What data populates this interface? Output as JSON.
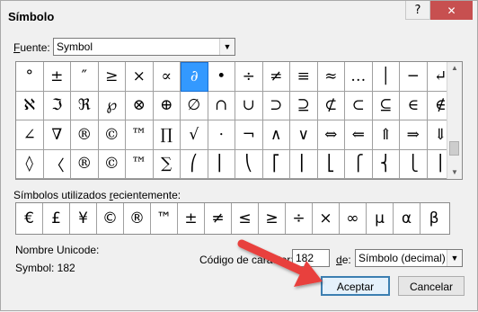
{
  "window": {
    "title": "Símbolo",
    "help_label": "?",
    "close_label": "✕"
  },
  "font": {
    "label_prefix": "",
    "label_accel": "F",
    "label_rest": "uente:",
    "value": "Symbol"
  },
  "symbols": [
    "°",
    "±",
    "″",
    "≥",
    "×",
    "∝",
    "∂",
    "•",
    "÷",
    "≠",
    "≡",
    "≈",
    "…",
    "│",
    "─",
    "↵",
    "ℵ",
    "ℑ",
    "ℜ",
    "℘",
    "⊗",
    "⊕",
    "∅",
    "∩",
    "∪",
    "⊃",
    "⊇",
    "⊄",
    "⊂",
    "⊆",
    "∈",
    "∉",
    "∠",
    "∇",
    "®",
    "©",
    "™",
    "∏",
    "√",
    "⋅",
    "¬",
    "∧",
    "∨",
    "⇔",
    "⇐",
    "⇑",
    "⇒",
    "⇓",
    "◊",
    "〈",
    "®",
    "©",
    "™",
    "∑",
    "⎛",
    "⎜",
    "⎝",
    "⎡",
    "⎢",
    "⎣",
    "⎧",
    "⎨",
    "⎩",
    "⎪"
  ],
  "selected_index": 6,
  "recent": {
    "label_prefix": "Símbolos utilizados ",
    "label_accel": "r",
    "label_rest": "ecientemente:",
    "symbols": [
      "€",
      "£",
      "¥",
      "©",
      "®",
      "™",
      "±",
      "≠",
      "≤",
      "≥",
      "÷",
      "×",
      "∞",
      "µ",
      "α",
      "β"
    ]
  },
  "unicode_name_label": "Nombre Unicode:",
  "symbol_code": "Symbol: 182",
  "char_code": {
    "label": "Código de carácter:",
    "value": "182"
  },
  "from": {
    "label_accel": "d",
    "label_rest": "e:",
    "value": "Símbolo (decimal)"
  },
  "buttons": {
    "ok": "Aceptar",
    "cancel": "Cancelar"
  },
  "colors": {
    "selection": "#3399ff",
    "close": "#c75050",
    "annotation_arrow": "#e8413c"
  }
}
